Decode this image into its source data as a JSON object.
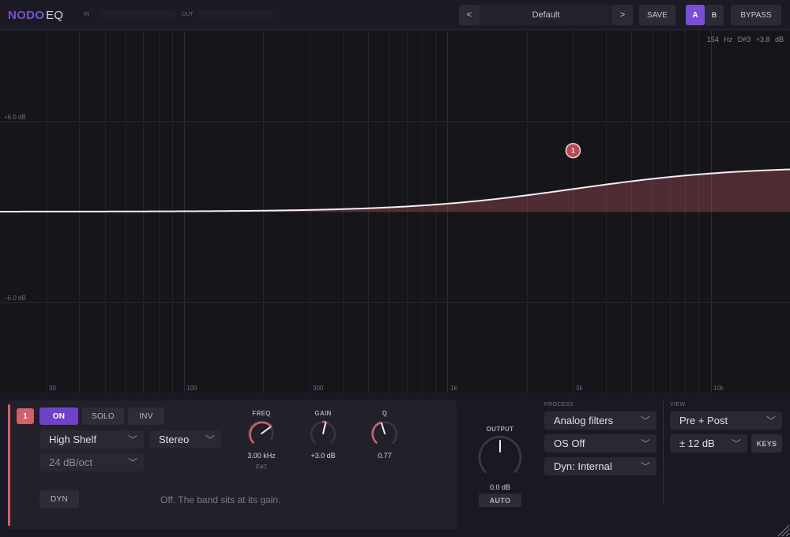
{
  "header": {
    "brand": "NODO",
    "product": "EQ",
    "meter_in": "IN",
    "meter_out": "OUT",
    "preset_prev": "<",
    "preset_name": "Default",
    "preset_next": ">",
    "save": "SAVE",
    "slot_a": "A",
    "slot_b": "B",
    "bypass": "BYPASS"
  },
  "graph": {
    "readout": "154 Hz   D#3   +3.8 dB",
    "gain_labels": [
      "+6.0 dB",
      "−6.0 dB"
    ],
    "freq_labels": [
      "30",
      "100",
      "300",
      "1k",
      "3k",
      "10k"
    ],
    "node_label": "1"
  },
  "band": {
    "number": "1",
    "on": "ON",
    "solo": "SOLO",
    "inv": "INV",
    "type": "High Shelf",
    "channel": "Stereo",
    "slope": "24 dB/oct",
    "dyn": "DYN",
    "dyn_message": "Off. The band sits at its gain.",
    "freq_label": "FREQ",
    "freq_value": "3.00 kHz",
    "freq_note": "F#7",
    "gain_label": "GAIN",
    "gain_value": "+3.0 dB",
    "q_label": "Q",
    "q_value": "0.77"
  },
  "output": {
    "label": "OUTPUT",
    "value": "0.0 dB",
    "auto": "AUTO"
  },
  "process": {
    "label": "PROCESS",
    "filters": "Analog filters",
    "oversampling": "OS Off",
    "dynamics": "Dyn: Internal"
  },
  "view": {
    "label": "VIEW",
    "mode": "Pre + Post",
    "range": "± 12 dB",
    "keys": "KEYS"
  },
  "curve": {
    "band_type": "high-shelf",
    "freq_hz": 3000,
    "gain_db": 3.0,
    "q": 0.77,
    "slope_db_oct": 24,
    "accent": "#d0616a"
  },
  "colors": {
    "accent": "#7a4fd8",
    "band1": "#d0616a"
  }
}
